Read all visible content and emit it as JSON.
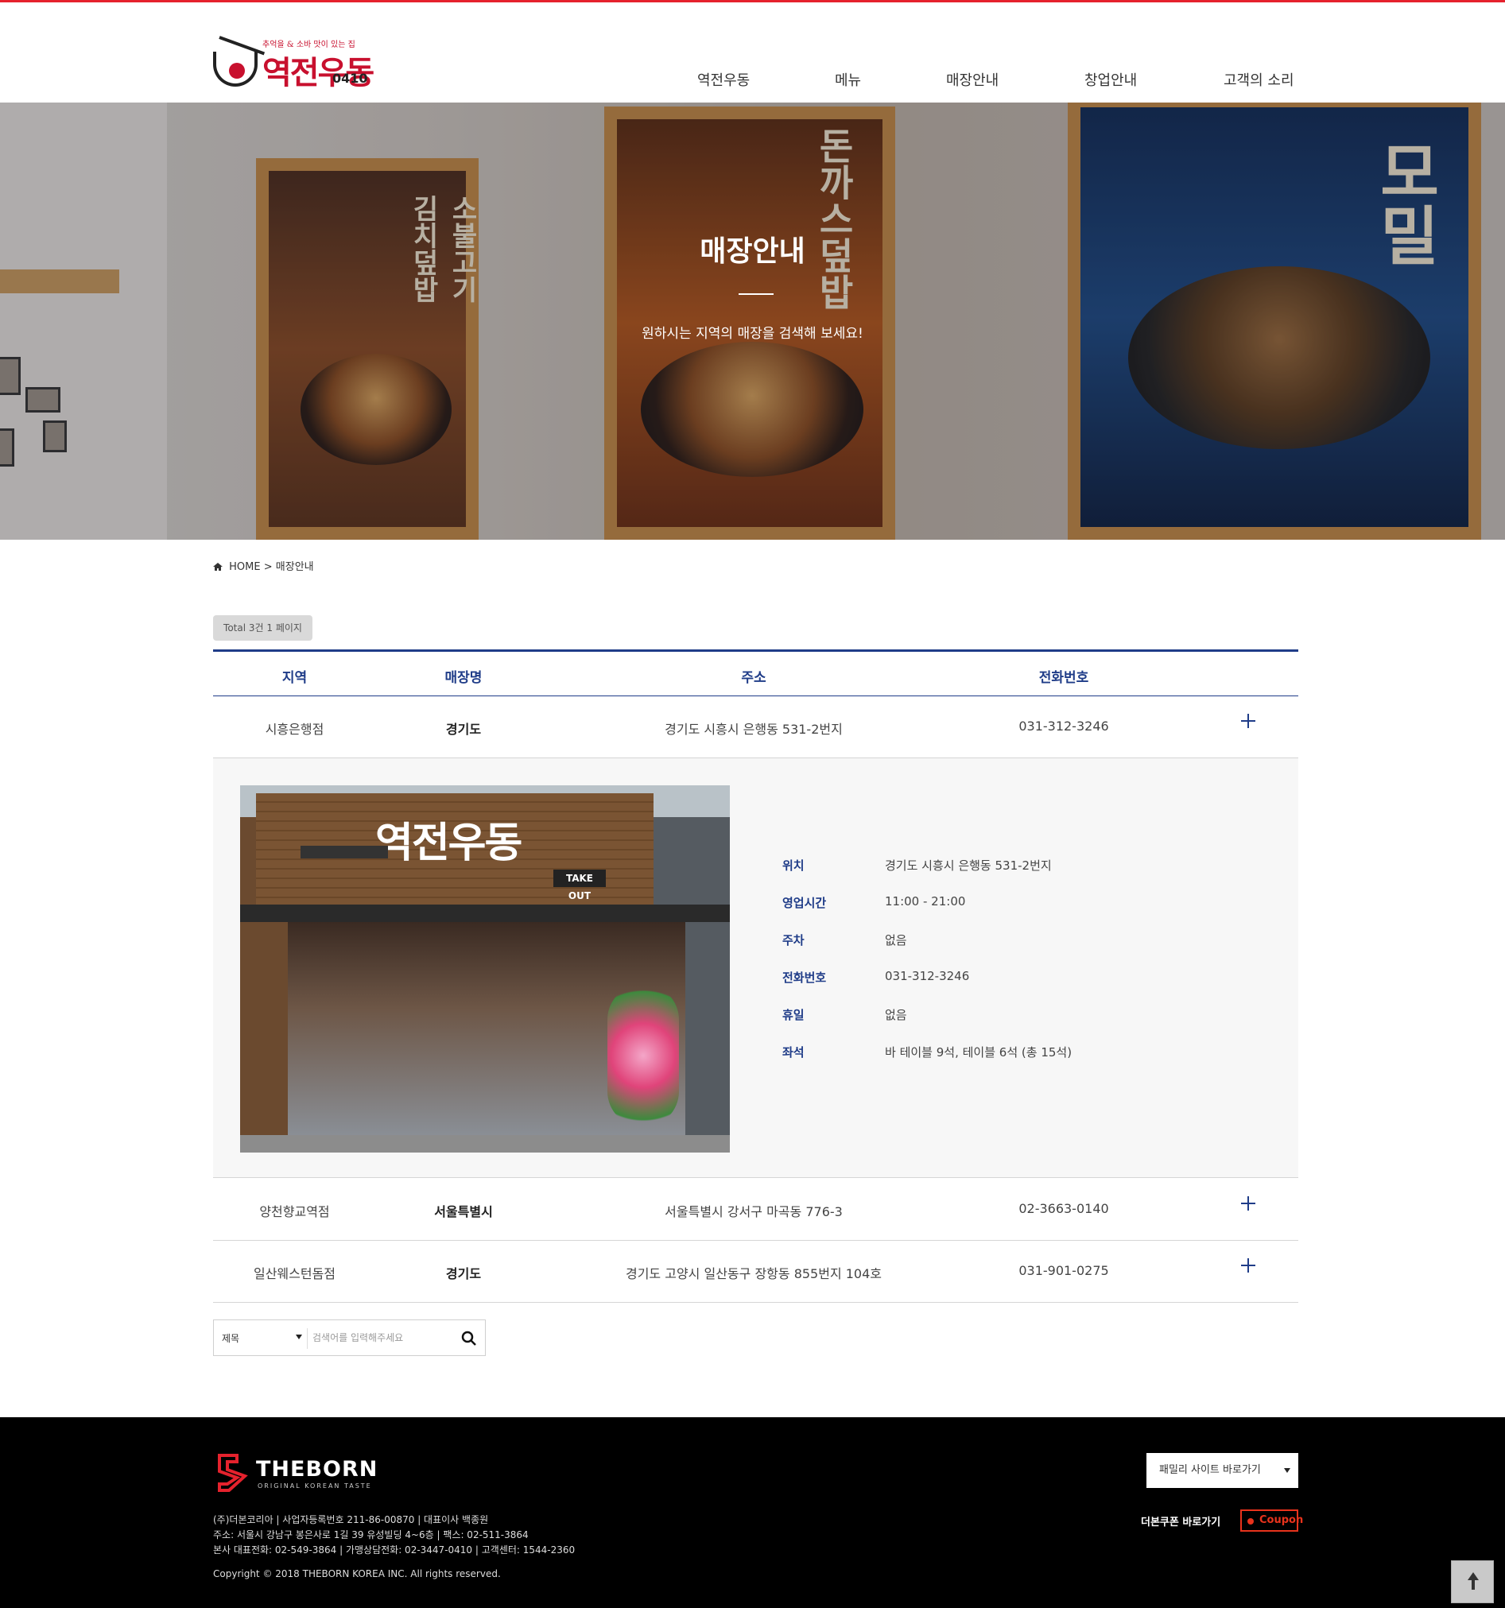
{
  "header": {
    "logo_text": "역전우동",
    "logo_num": "0410",
    "logo_sub": "추억을 & 소바 맛이 있는 집",
    "nav": [
      "역전우동",
      "메뉴",
      "매장안내",
      "창업안내",
      "고객의 소리"
    ]
  },
  "banner": {
    "title": "매장안내",
    "subtitle": "원하시는 지역의 매장을 검색해 보세요!"
  },
  "breadcrumb": {
    "home": "HOME",
    "separator": ">",
    "current": "매장안내"
  },
  "total_badge": "Total 3건 1 페이지",
  "table": {
    "headers": [
      "지역",
      "매장명",
      "주소",
      "전화번호"
    ],
    "rows": [
      {
        "region": "시흥은행점",
        "store": "경기도",
        "address": "경기도 시흥시 은행동 531-2번지",
        "phone": "031-312-3246"
      },
      {
        "region": "양천향교역점",
        "store": "서울특별시",
        "address": "서울특별시 강서구 마곡동 776-3",
        "phone": "02-3663-0140"
      },
      {
        "region": "일산웨스턴돔점",
        "store": "경기도",
        "address": "경기도 고양시 일산동구 장항동 855번지 104호",
        "phone": "031-901-0275"
      }
    ]
  },
  "detail": {
    "labels": [
      "위치",
      "영업시간",
      "주차",
      "전화번호",
      "휴일",
      "좌석"
    ],
    "values": [
      "경기도 시흥시 은행동 531-2번지",
      "11:00 - 21:00",
      "없음",
      "031-312-3246",
      "없음",
      "바 테이블 9석, 테이블 6석 (총 15석)"
    ],
    "photo": {
      "sign_text": "역전우동",
      "takeout": "TAKE OUT"
    }
  },
  "search": {
    "select_value": "제목",
    "placeholder": "검색어를 입력해주세요"
  },
  "footer": {
    "brand": "THEBORN",
    "tagline": "ORIGINAL KOREAN TASTE",
    "info_lines": [
      "(주)더본코리아 | 사업자등록번호 211-86-00870 | 대표이사 백종원",
      "주소: 서울시 강남구 봉은사로 1길 39 유성빌딩 4~6층 | 팩스: 02-511-3864",
      "본사 대표전화: 02-549-3864 | 가맹상담전화: 02-3447-0410 | 고객센터: 1544-2360"
    ],
    "copyright": "Copyright © 2018 THEBORN KOREA INC. All rights reserved.",
    "family_select": "패밀리 사이트 바로가기",
    "coupon_label": "더본쿠폰 바로가기",
    "coupon_button": "Coupon"
  },
  "colors": {
    "accent": "#1f3c88",
    "brand_red": "#c8102e",
    "coupon": "#e8331c"
  }
}
